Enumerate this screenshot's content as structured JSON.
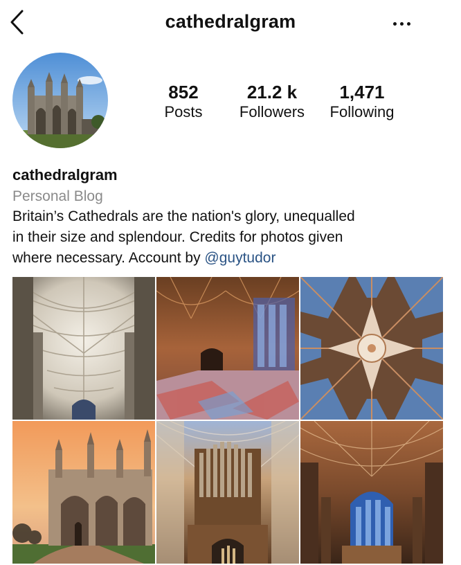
{
  "header": {
    "title": "cathedralgram",
    "back_icon": "chevron-left-icon",
    "more_icon": "more-horizontal-icon"
  },
  "profile": {
    "avatar": "cathedral-facade-photo",
    "stats": {
      "posts": {
        "value": "852",
        "label": "Posts"
      },
      "followers": {
        "value": "21.2 k",
        "label": "Followers"
      },
      "following": {
        "value": "1,471",
        "label": "Following"
      }
    },
    "name": "cathedralgram",
    "category": "Personal Blog",
    "bio_line1": "Britain’s Cathedrals are the nation's glory, unequalled",
    "bio_line2": "in their size and splendour. Credits for photos given",
    "bio_line3_prefix": "where necessary. Account by ",
    "bio_mention": "@guytudor"
  },
  "colors": {
    "mention_link": "#2a5384",
    "category_gray": "#8a8a8a"
  },
  "grid": {
    "posts": [
      "nave-vault-photo",
      "cloister-fan-vault-photo",
      "chapter-house-ceiling-photo",
      "cathedral-west-front-photo",
      "organ-screen-photo",
      "choir-interior-photo"
    ]
  }
}
